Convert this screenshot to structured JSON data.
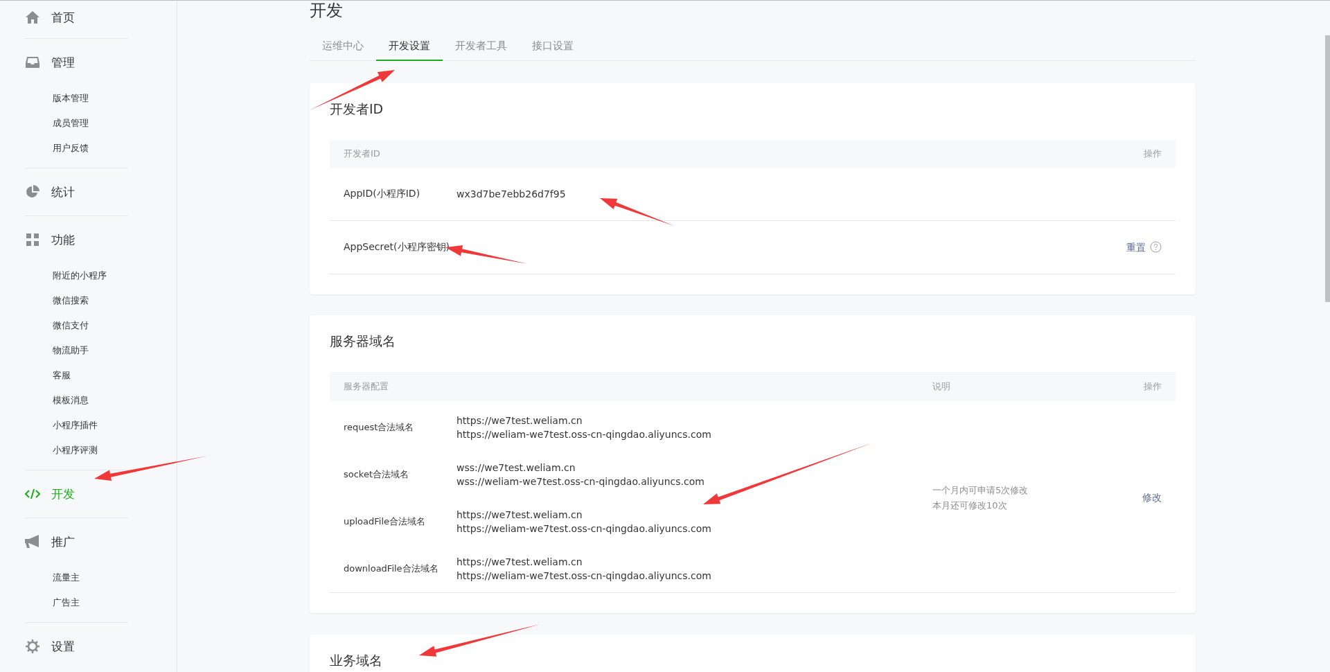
{
  "sidebar": [
    {
      "label": "首页",
      "selected": false
    },
    {
      "label": "管理",
      "selected": false,
      "children": [
        {
          "label": "版本管理"
        },
        {
          "label": "成员管理"
        },
        {
          "label": "用户反馈"
        }
      ]
    },
    {
      "label": "统计",
      "selected": false
    },
    {
      "label": "功能",
      "selected": false,
      "children": [
        {
          "label": "附近的小程序"
        },
        {
          "label": "微信搜索"
        },
        {
          "label": "微信支付"
        },
        {
          "label": "物流助手"
        },
        {
          "label": "客服"
        },
        {
          "label": "模板消息"
        },
        {
          "label": "小程序插件"
        },
        {
          "label": "小程序评测"
        }
      ]
    },
    {
      "label": "开发",
      "selected": true
    },
    {
      "label": "推广",
      "selected": false,
      "children": [
        {
          "label": "流量主"
        },
        {
          "label": "广告主"
        }
      ]
    },
    {
      "label": "设置",
      "selected": false
    }
  ],
  "page_title": "开发",
  "tabs": [
    {
      "label": "运维中心",
      "selected": false
    },
    {
      "label": "开发设置",
      "selected": true
    },
    {
      "label": "开发者工具",
      "selected": false
    },
    {
      "label": "接口设置",
      "selected": false
    }
  ],
  "developer_id": {
    "title": "开发者ID",
    "columns": [
      "开发者ID",
      "操作"
    ],
    "rows": [
      {
        "label": "AppID(小程序ID)",
        "value": "wx3d7be7ebb26d7f95"
      },
      {
        "label": "AppSecret(小程序密钥)",
        "action": "重置"
      }
    ]
  },
  "server_domains": {
    "title": "服务器域名",
    "columns": [
      "服务器配置",
      "说明",
      "操作"
    ],
    "rows": [
      {
        "name": "request合法域名",
        "urls": [
          "https://we7test.weliam.cn",
          "https://weliam-we7test.oss-cn-qingdao.aliyuncs.com"
        ]
      },
      {
        "name": "socket合法域名",
        "urls": [
          "wss://we7test.weliam.cn",
          "wss://weliam-we7test.oss-cn-qingdao.aliyuncs.com"
        ]
      },
      {
        "name": "uploadFile合法域名",
        "urls": [
          "https://we7test.weliam.cn",
          "https://weliam-we7test.oss-cn-qingdao.aliyuncs.com"
        ]
      },
      {
        "name": "downloadFile合法域名",
        "urls": [
          "https://we7test.weliam.cn",
          "https://weliam-we7test.oss-cn-qingdao.aliyuncs.com"
        ]
      }
    ],
    "note": [
      "一个月内可申请5次修改",
      "本月还可修改10次"
    ],
    "action": "修改"
  },
  "business_domain": {
    "title": "业务域名"
  }
}
